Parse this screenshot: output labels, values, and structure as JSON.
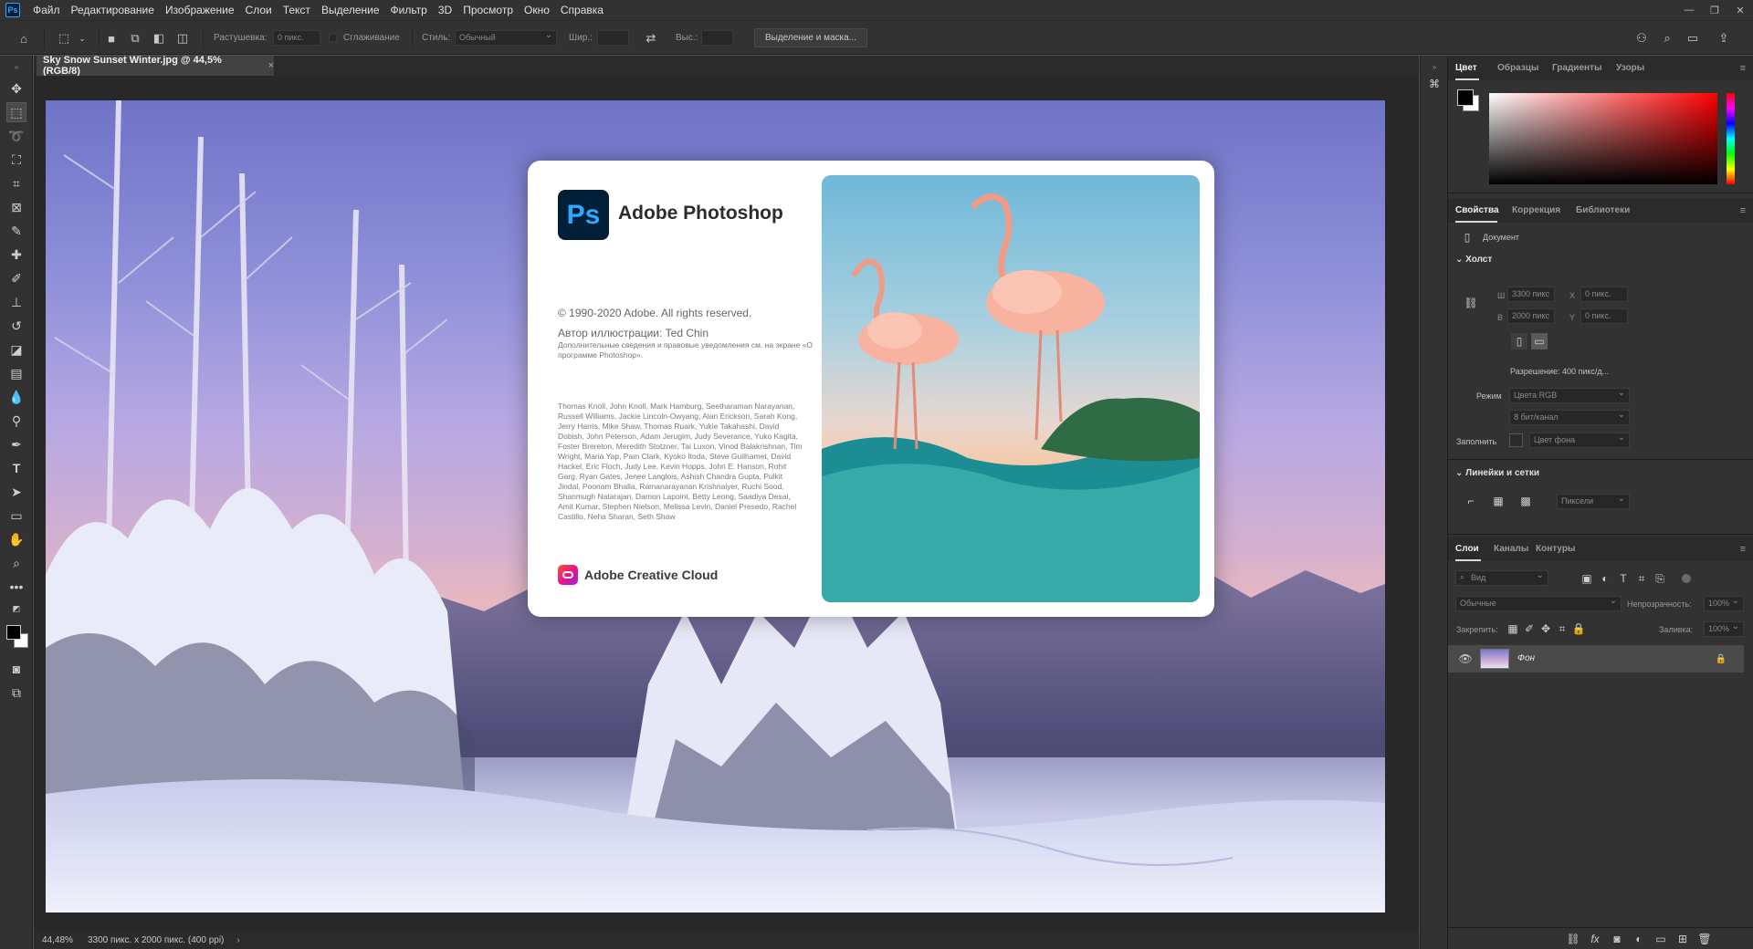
{
  "menubar": {
    "app_icon": "Ps",
    "items": [
      "Файл",
      "Редактирование",
      "Изображение",
      "Слои",
      "Текст",
      "Выделение",
      "Фильтр",
      "3D",
      "Просмотр",
      "Окно",
      "Справка"
    ]
  },
  "options": {
    "feather_label": "Растушевка:",
    "feather_value": "0 пикс.",
    "antialias_label": "Сглаживание",
    "style_label": "Стиль:",
    "style_value": "Обычный",
    "width_label": "Шир.:",
    "height_label": "Выс.:",
    "mask_button": "Выделение и маска..."
  },
  "document": {
    "tab_title": "Sky Snow Sunset Winter.jpg @ 44,5% (RGB/8)",
    "tab_close": "×"
  },
  "status": {
    "zoom": "44,48%",
    "info": "3300 пикс. x 2000 пикс. (400 ppi)",
    "arrow": "›"
  },
  "splash": {
    "logo": "Ps",
    "title": "Adobe Photoshop",
    "copyright": "© 1990-2020 Adobe. All rights reserved.",
    "author": "Автор иллюстрации: Ted Chin",
    "notice": "Дополнительные сведения и правовые уведомления см. на экране «О программе Photoshop».",
    "credits": "Thomas Knoll, John Knoll, Mark Hamburg, Seetharaman Narayanan, Russell Williams, Jackie Lincoln-Owyang, Alan Erickson, Sarah Kong, Jerry Harris, Mike Shaw, Thomas Ruark, Yukie Takahashi, David Dobish, John Peterson, Adam Jerugim, Judy Severance, Yuko Kagita, Foster Brereton, Meredith Stotzner, Tai Luxon, Vinod Balakrishnan, Tim Wright, Maria Yap, Pam Clark, Kyoko Itoda, Steve Guilhamet, David Hackel, Eric Floch, Judy Lee, Kevin Hopps, John E. Hanson, Rohit Garg, Ryan Gates, Jenee Langlois, Ashish Chandra Gupta, Pulkit Jindal, Poonam Bhalla, Ramanarayanan Krishnaiyer, Ruchi Sood, Shanmugh Natarajan, Damon Lapoint, Betty Leong, Saadiya Desai, Amit Kumar, Stephen Nielson, Melissa Levin, Daniel Presedo, Rachel Castillo, Neha Sharan, Seth Shaw",
    "cc_label": "Adobe Creative Cloud"
  },
  "color_panel": {
    "tabs": [
      "Цвет",
      "Образцы",
      "Градиенты",
      "Узоры"
    ],
    "fg_color": "#000000",
    "bg_color": "#ffffff",
    "hue_color": "#ff0000"
  },
  "properties_panel": {
    "tabs": [
      "Свойства",
      "Коррекция",
      "Библиотеки"
    ],
    "doc_label": "Документ",
    "canvas_section": "Холст",
    "w_label": "Ш",
    "w_value": "3300 пикс",
    "h_label": "В",
    "h_value": "2000 пикс",
    "x_label": "X",
    "x_value": "0 пикс.",
    "y_label": "Y",
    "y_value": "0 пикс.",
    "resolution": "Разрешение: 400 пикс/д...",
    "mode_label": "Режим",
    "mode_value": "Цвета RGB",
    "depth_value": "8 бит/канал",
    "fill_label": "Заполнить",
    "fill_value": "Цвет фона",
    "rulers_section": "Линейки и сетки",
    "units_value": "Пиксели"
  },
  "layers_panel": {
    "tabs": [
      "Слои",
      "Каналы",
      "Контуры"
    ],
    "kind_value": "Вид",
    "blend_value": "Обычные",
    "opacity_label": "Непрозрачность:",
    "opacity_value": "100%",
    "lock_label": "Закрепить:",
    "fill_label": "Заливка:",
    "fill_value": "100%",
    "layers": [
      {
        "name": "Фон",
        "visible": true,
        "locked": true
      }
    ]
  }
}
